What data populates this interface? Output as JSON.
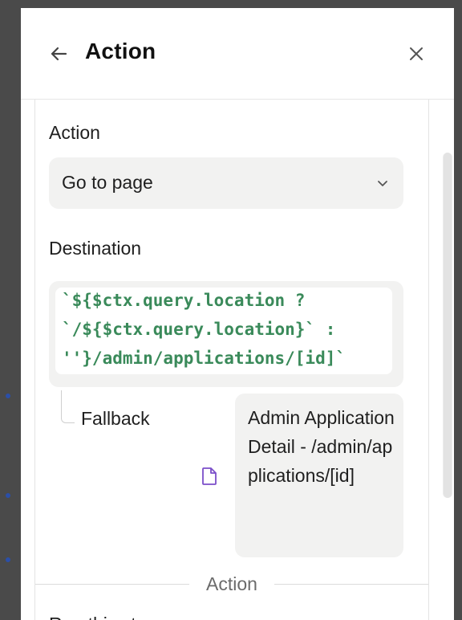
{
  "header": {
    "title": "Action",
    "back_icon": "arrow-left-icon",
    "close_icon": "close-icon"
  },
  "action_section": {
    "label": "Action",
    "select_value": "Go to page",
    "chevron_icon": "chevron-down-icon"
  },
  "destination": {
    "label": "Destination",
    "code_lines": [
      "`${$ctx.query.location ?",
      "`/${$ctx.query.location}` :",
      "''}/admin/applications/[id]`"
    ],
    "code_color": "#3a8a5a"
  },
  "fallback": {
    "label": "Fallback",
    "icon": "page-icon",
    "icon_color": "#7b4fc9",
    "value": "Admin Application Detail - /admin/applications/[id]"
  },
  "divider": {
    "label": "Action"
  },
  "next": {
    "label": "Run this step"
  }
}
